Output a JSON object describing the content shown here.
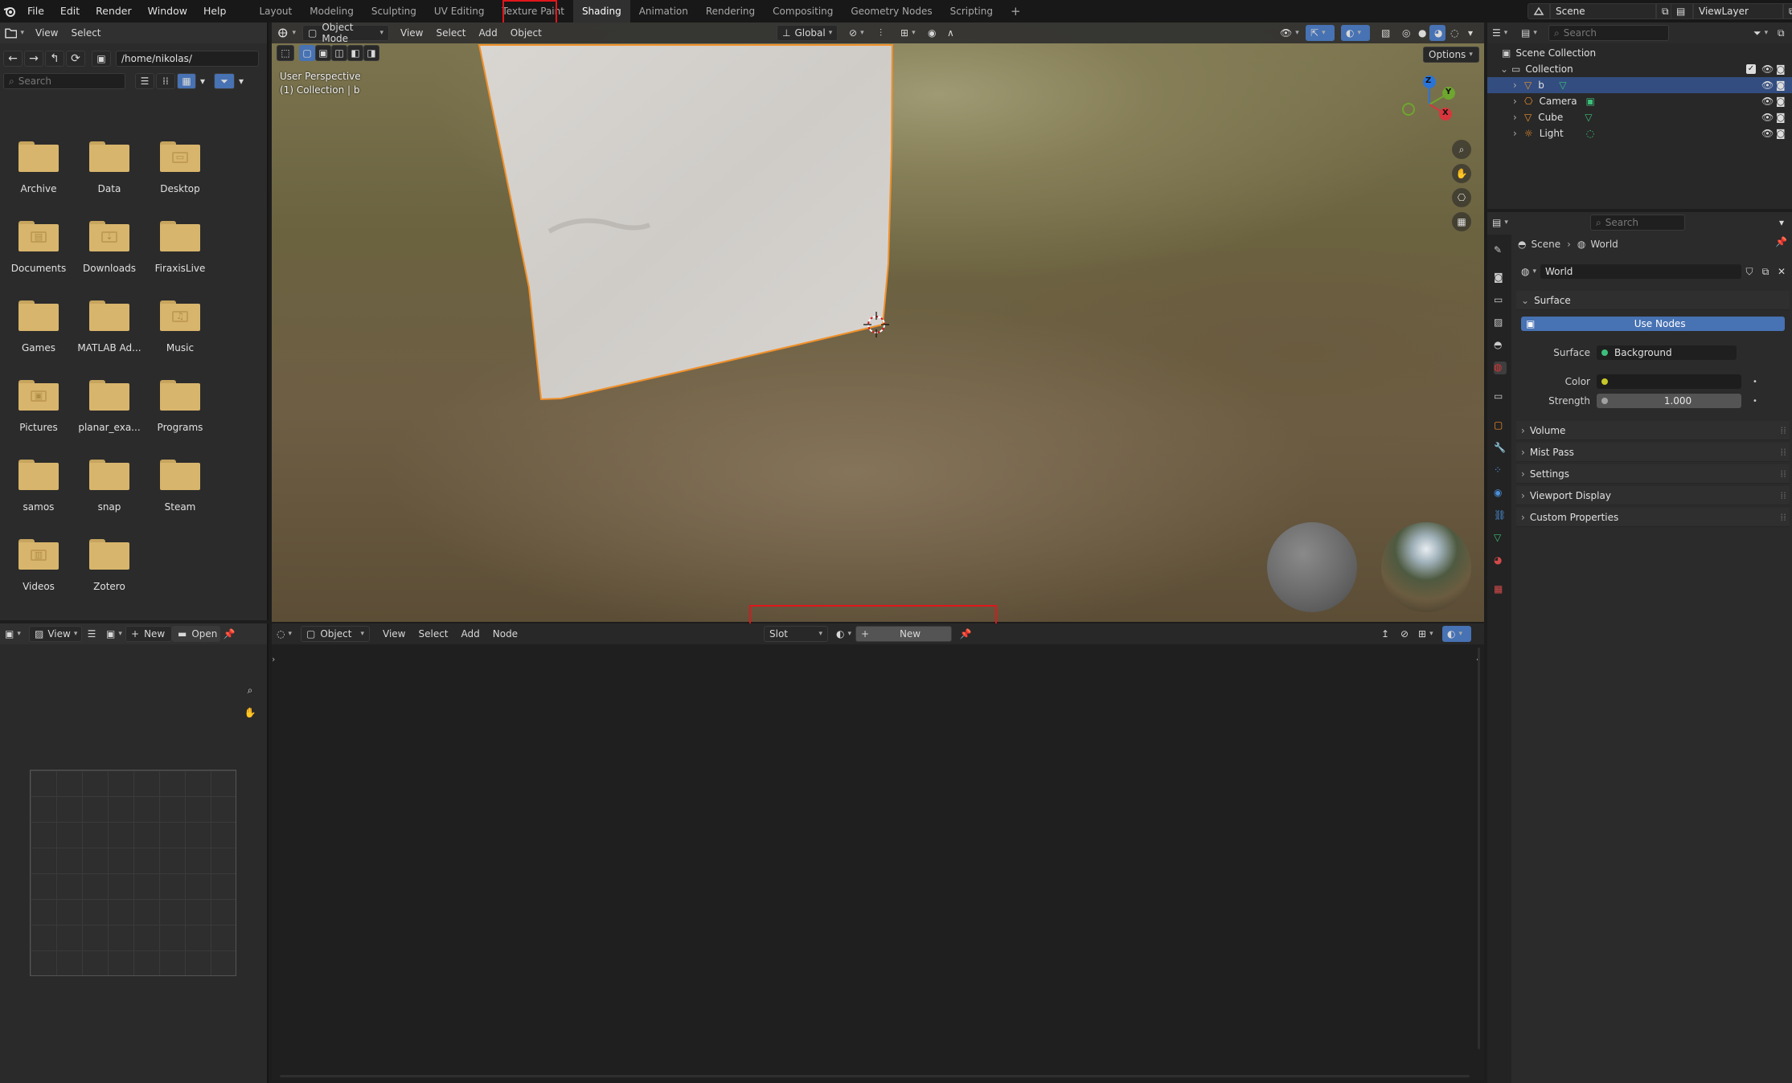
{
  "topbar": {
    "menus": [
      "File",
      "Edit",
      "Render",
      "Window",
      "Help"
    ],
    "workspaces": [
      "Layout",
      "Modeling",
      "Sculpting",
      "UV Editing",
      "Texture Paint",
      "Shading",
      "Animation",
      "Rendering",
      "Compositing",
      "Geometry Nodes",
      "Scripting"
    ],
    "active_workspace": "Shading",
    "add_tab": "+",
    "scene": "Scene",
    "view_layer": "ViewLayer"
  },
  "file_browser": {
    "menus": [
      "View",
      "Select"
    ],
    "path": "/home/nikolas/",
    "search_placeholder": "Search",
    "items": [
      {
        "label": "Archive",
        "glyph": ""
      },
      {
        "label": "Data",
        "glyph": ""
      },
      {
        "label": "Desktop",
        "glyph": "▭"
      },
      {
        "label": "Documents",
        "glyph": "▤"
      },
      {
        "label": "Downloads",
        "glyph": "⇣"
      },
      {
        "label": "FiraxisLive",
        "glyph": ""
      },
      {
        "label": "Games",
        "glyph": ""
      },
      {
        "label": "MATLAB Ad...",
        "glyph": ""
      },
      {
        "label": "Music",
        "glyph": "♫"
      },
      {
        "label": "Pictures",
        "glyph": "▣"
      },
      {
        "label": "planar_exa...",
        "glyph": ""
      },
      {
        "label": "Programs",
        "glyph": ""
      },
      {
        "label": "samos",
        "glyph": ""
      },
      {
        "label": "snap",
        "glyph": ""
      },
      {
        "label": "Steam",
        "glyph": ""
      },
      {
        "label": "Videos",
        "glyph": "▥"
      },
      {
        "label": "Zotero",
        "glyph": ""
      }
    ]
  },
  "viewport": {
    "mode": "Object Mode",
    "menus": [
      "View",
      "Select",
      "Add",
      "Object"
    ],
    "transform_orientation": "Global",
    "options": "Options",
    "perspective": "User Perspective",
    "collection_info": "(1) Collection | b",
    "gizmo_axes": {
      "x": "X",
      "y": "Y",
      "z": "Z"
    }
  },
  "image_editor": {
    "view": "View",
    "new": "New",
    "open": "Open"
  },
  "node_editor": {
    "object": "Object",
    "menus": [
      "View",
      "Select",
      "Add",
      "Node"
    ],
    "slot": "Slot",
    "new": "New"
  },
  "outliner": {
    "search_placeholder": "Search",
    "scene_collection": "Scene Collection",
    "collection": "Collection",
    "objects": [
      "b",
      "Camera",
      "Cube",
      "Light"
    ]
  },
  "properties": {
    "search_placeholder": "Search",
    "breadcrumb": [
      "Scene",
      "World"
    ],
    "world_name": "World",
    "surface_header": "Surface",
    "use_nodes": "Use Nodes",
    "surface_label": "Surface",
    "surface_value": "Background",
    "color_label": "Color",
    "strength_label": "Strength",
    "strength_value": "1.000",
    "collapsed_sections": [
      "Volume",
      "Mist Pass",
      "Settings",
      "Viewport Display",
      "Custom Properties"
    ]
  },
  "colors": {
    "accent": "#4772b3",
    "selection": "#334d80",
    "highlight": "#e0161b",
    "object_outline": "#f0902a"
  }
}
